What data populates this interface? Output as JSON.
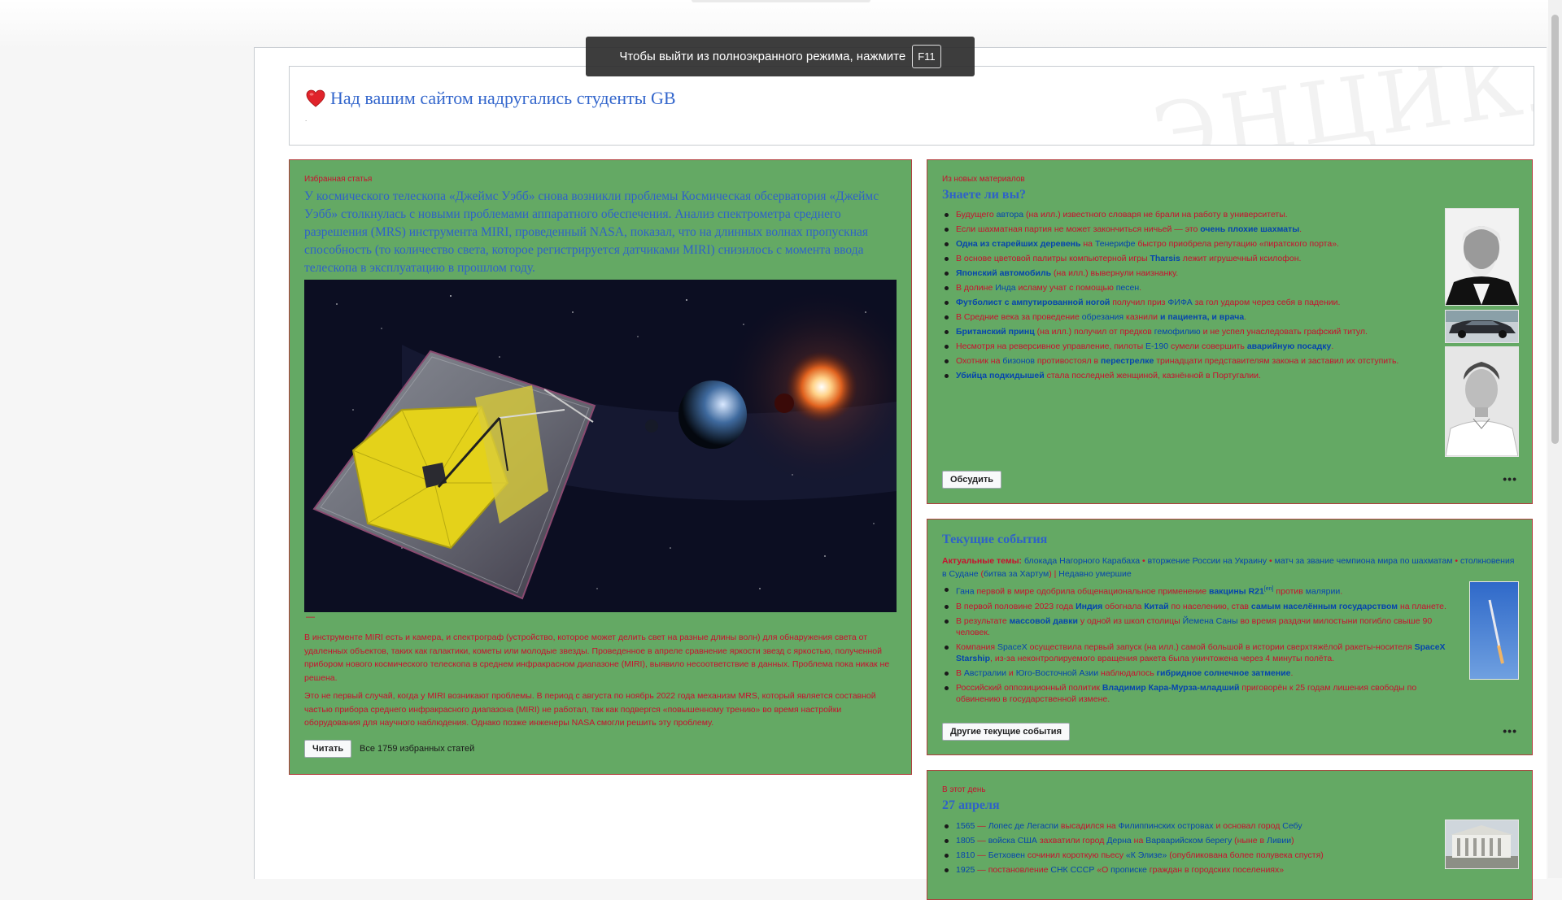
{
  "fullscreen_notice": {
    "text": "Чтобы выйти из полноэкранного режима, нажмите",
    "key": "F11"
  },
  "header": {
    "title": "Над вашим сайтом надругались студенты GB",
    "watermark": "ЭНЦИКЛОПЕДИЯ",
    "dot": "."
  },
  "featured": {
    "label": "Избранная статья",
    "lead": "У космического телескопа «Джеймс Уэбб» снова возникли проблемы Космическая обсерватория «Джеймс Уэбб» столкнулась с новыми проблемами аппаратного обеспечения. Анализ спектрометра среднего разрешения (MRS) инструмента MIRI, проведенный NASA, показал, что на длинных волнах пропускная способность (то количество света, которое регистрируется датчиками MIRI) снизилось с момента ввода телескопа в эксплуатацию в прошлом году.",
    "caption_dash": "—",
    "paragraph1": "В инструменте MIRI есть и камера, и спектрограф (устройство, которое может делить свет на разные длины волн) для обнаружения света от удаленных объектов, таких как галактики, кометы или молодые звезды. Проведенное в апреле сравнение яркости звезд с яркостью, полученной прибором нового космического телескопа в среднем инфракрасном диапазоне (MIRI), выявило несоответствие в данных. Проблема пока никак не решена.",
    "paragraph2": "Это не первый случай, когда у MIRI возникают проблемы. В период с августа по ноябрь 2022 года механизм MRS, который является составной частью прибора среднего инфракрасного диапазона (MIRI) не работал, так как подвергся «повышенному трению» во время настройки оборудования для научного наблюдения. Однако позже инженеры NASA смогли решить эту проблему.",
    "read_button": "Читать",
    "all_link": "Все 1759 избранных статей"
  },
  "dyk": {
    "label": "Из новых материалов",
    "title": "Знаете ли вы?",
    "items": [
      [
        [
          "Будущего ",
          "r"
        ],
        [
          "автора",
          "b"
        ],
        [
          " (на илл.) ",
          "r"
        ],
        [
          "известного словаря не брали на работу в университеты.",
          "r"
        ]
      ],
      [
        [
          "Если шахматная партия не может закончиться ничьей — это ",
          "r"
        ],
        [
          "очень плохие шахматы",
          "bb"
        ],
        [
          ".",
          "r"
        ]
      ],
      [
        [
          "Одна из старейших деревень",
          "bb"
        ],
        [
          " на ",
          "r"
        ],
        [
          "Тенерифе",
          "b"
        ],
        [
          " быстро приобрела репутацию «пиратского порта».",
          "r"
        ]
      ],
      [
        [
          "В основе цветовой палитры компьютерной игры ",
          "r"
        ],
        [
          "Tharsis",
          "bb"
        ],
        [
          " лежит игрушечный ксилофон.",
          "r"
        ]
      ],
      [
        [
          "Японский автомобиль",
          "bb"
        ],
        [
          " (на илл.) вывернули наизнанку.",
          "r"
        ]
      ],
      [
        [
          "В долине ",
          "r"
        ],
        [
          "Инда",
          "b"
        ],
        [
          " исламу учат с помощью ",
          "r"
        ],
        [
          "песен",
          "b"
        ],
        [
          ".",
          "r"
        ]
      ],
      [
        [
          "Футболист с ампутированной ногой",
          "bb"
        ],
        [
          " получил приз ",
          "r"
        ],
        [
          "ФИФА",
          "b"
        ],
        [
          " за гол ударом через себя в падении.",
          "r"
        ]
      ],
      [
        [
          "В Средние века за проведение ",
          "r"
        ],
        [
          "обрезания",
          "b"
        ],
        [
          " казнили ",
          "r"
        ],
        [
          "и пациента, и врача",
          "bb"
        ],
        [
          ".",
          "r"
        ]
      ],
      [
        [
          "Британский принц",
          "bb"
        ],
        [
          " (на илл.) получил от предков ",
          "r"
        ],
        [
          "гемофилию",
          "b"
        ],
        [
          " и не успел унаследовать графский титул.",
          "r"
        ]
      ],
      [
        [
          "Несмотря на реверсивное управление, пилоты ",
          "r"
        ],
        [
          "E-190",
          "b"
        ],
        [
          " сумели совершить ",
          "r"
        ],
        [
          "аварийную посадку",
          "bb"
        ],
        [
          ".",
          "r"
        ]
      ],
      [
        [
          "Охотник на ",
          "r"
        ],
        [
          "бизонов",
          "b"
        ],
        [
          " противостоял в ",
          "r"
        ],
        [
          "перестрелке",
          "bb"
        ],
        [
          " тринадцати представителям закона и заставил их отступить.",
          "r"
        ]
      ],
      [
        [
          "Убийца подкидышей",
          "bb"
        ],
        [
          " стала последней женщиной, казнённой в Португалии.",
          "r"
        ]
      ]
    ],
    "button": "Обсудить",
    "more": "•••"
  },
  "news": {
    "title": "Текущие события",
    "topics_label": "Актуальные темы:",
    "topics": [
      [
        "блокада Нагорного Карабаха",
        "b"
      ],
      [
        " • ",
        "r"
      ],
      [
        "вторжение России на Украину",
        "b"
      ],
      [
        " • ",
        "r"
      ],
      [
        "матч за звание чемпиона мира по шахматам",
        "b"
      ],
      [
        " • ",
        "r"
      ],
      [
        "столкновения в Судане",
        "b"
      ],
      [
        " (",
        "r"
      ],
      [
        "битва за Хартум",
        "b"
      ],
      [
        ") | ",
        "r"
      ],
      [
        "Недавно умершие",
        "b"
      ]
    ],
    "items": [
      [
        [
          "Гана",
          "b"
        ],
        [
          " первой в мире одобрила общенациональное применение ",
          "r"
        ],
        [
          "вакцины R21",
          "bb"
        ],
        [
          "[en]",
          "s"
        ],
        [
          " против ",
          "r"
        ],
        [
          "малярии",
          "b"
        ],
        [
          ".",
          "r"
        ]
      ],
      [
        [
          "В первой половине 2023 года ",
          "r"
        ],
        [
          "Индия",
          "bb"
        ],
        [
          " обогнала ",
          "r"
        ],
        [
          "Китай",
          "bb"
        ],
        [
          " по населению, став ",
          "r"
        ],
        [
          "самым населённым государством",
          "bb"
        ],
        [
          " на планете.",
          "r"
        ]
      ],
      [
        [
          "В результате ",
          "r"
        ],
        [
          "массовой давки",
          "bb"
        ],
        [
          " у одной из школ столицы ",
          "r"
        ],
        [
          "Йемена",
          "b"
        ],
        [
          " ",
          "r"
        ],
        [
          "Саны",
          "b"
        ],
        [
          " во время раздачи милостыни погибло свыше 90 человек.",
          "r"
        ]
      ],
      [
        [
          "Компания ",
          "r"
        ],
        [
          "SpaceX",
          "b"
        ],
        [
          " осуществила первый запуск (на илл.) самой большой в истории сверхтяжёлой ракеты-носителя ",
          "r"
        ],
        [
          "SpaceX Starship",
          "bb"
        ],
        [
          ", из-за неконтролируемого вращения ракета была уничтожена через 4 минуты полёта.",
          "r"
        ]
      ],
      [
        [
          "В ",
          "r"
        ],
        [
          "Австралии",
          "b"
        ],
        [
          " и ",
          "r"
        ],
        [
          "Юго-Восточной Азии",
          "b"
        ],
        [
          " наблюдалось ",
          "r"
        ],
        [
          "гибридное солнечное затмение",
          "bb"
        ],
        [
          ".",
          "r"
        ]
      ],
      [
        [
          "Российский оппозиционный политик ",
          "r"
        ],
        [
          "Владимир Кара-Мурза-младший",
          "bb"
        ],
        [
          " приговорён к 25 годам лишения свободы по обвинению в государственной измене.",
          "r"
        ]
      ]
    ],
    "button": "Другие текущие события",
    "more": "•••"
  },
  "otd": {
    "label": "В этот день",
    "title": "27 апреля",
    "items": [
      [
        [
          "1565",
          "b"
        ],
        [
          " — ",
          "r"
        ],
        [
          "Лопес де Легаспи",
          "b"
        ],
        [
          " высадился на ",
          "r"
        ],
        [
          "Филиппинских островах",
          "b"
        ],
        [
          " и основал город ",
          "r"
        ],
        [
          "Себу",
          "b"
        ]
      ],
      [
        [
          "1805",
          "b"
        ],
        [
          " — ",
          "r"
        ],
        [
          "войска США",
          "b"
        ],
        [
          " захватили город ",
          "r"
        ],
        [
          "Дерна",
          "b"
        ],
        [
          " на ",
          "r"
        ],
        [
          "Варварийском берегу",
          "b"
        ],
        [
          " (ныне в ",
          "r"
        ],
        [
          "Ливии",
          "b"
        ],
        [
          ")",
          "r"
        ]
      ],
      [
        [
          "1810",
          "b"
        ],
        [
          " — ",
          "r"
        ],
        [
          "Бетховен",
          "b"
        ],
        [
          " сочинил короткую пьесу ",
          "r"
        ],
        [
          "«К Элизе»",
          "b"
        ],
        [
          " (опубликована более полувека спустя)",
          "r"
        ]
      ],
      [
        [
          "1925",
          "b"
        ],
        [
          " — постановление ",
          "r"
        ],
        [
          "СНК СССР",
          "b"
        ],
        [
          " «О ",
          "r"
        ],
        [
          "прописке",
          "b"
        ],
        [
          " граждан в городских поселениях»",
          "r"
        ]
      ]
    ]
  }
}
